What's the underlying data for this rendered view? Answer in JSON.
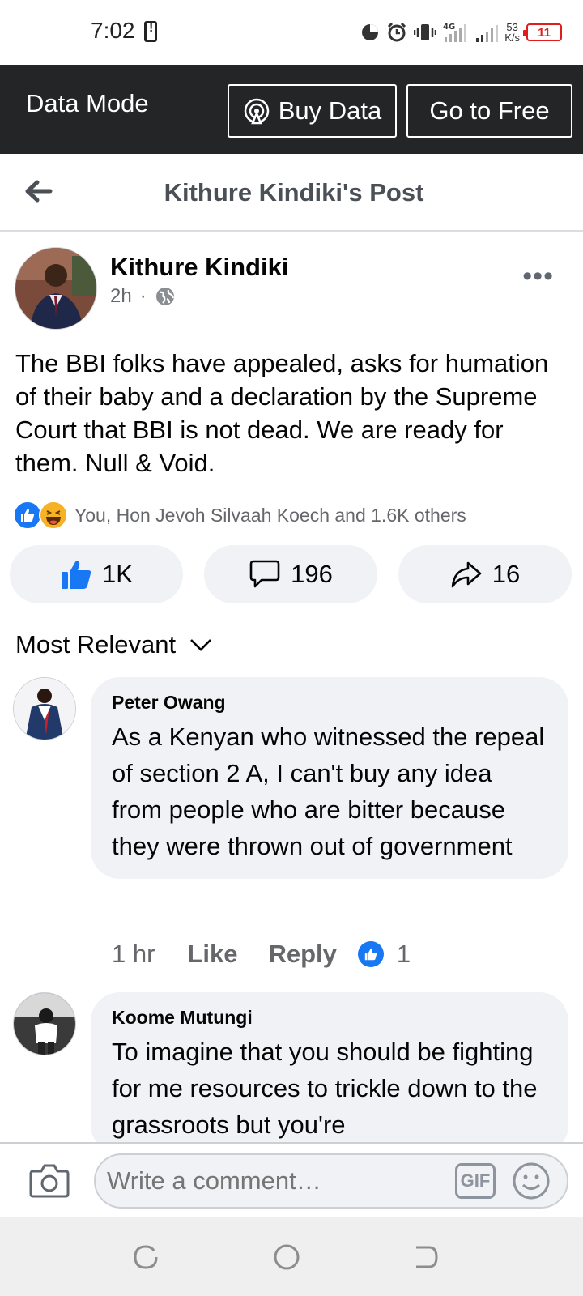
{
  "status_bar": {
    "time": "7:02",
    "network_speed_value": "53",
    "network_speed_unit": "K/s",
    "battery": "11",
    "network_type": "4G"
  },
  "data_mode_bar": {
    "title": "Data Mode",
    "buy_data_label": "Buy Data",
    "go_free_label": "Go to Free"
  },
  "header": {
    "title": "Kithure Kindiki's Post"
  },
  "post": {
    "author": "Kithure Kindiki",
    "time": "2h",
    "separator": "·",
    "text": "The BBI folks have appealed, asks for humation of their baby and a declaration by the Supreme Court that BBI is not dead. We are ready for them. Null & Void.",
    "reaction_summary": "You, Hon Jevoh Silvaah Koech and 1.6K others",
    "likes": "1K",
    "comments": "196",
    "shares": "16"
  },
  "sort_label": "Most Relevant",
  "comments": [
    {
      "author": "Peter Owang",
      "text": "As a Kenyan who witnessed the repeal of section 2 A, I can't buy any idea from people who are bitter because they were thrown out of government",
      "time": "1 hr",
      "like_label": "Like",
      "reply_label": "Reply",
      "reaction_count": "1"
    },
    {
      "author": "Koome Mutungi",
      "text": "To imagine that you should be fighting for me resources to trickle down to the grassroots but you're"
    }
  ],
  "composer": {
    "placeholder": "Write a comment…",
    "gif_label": "GIF"
  },
  "colors": {
    "facebook_blue": "#1877f2",
    "data_bar_bg": "#242526",
    "bubble_bg": "#f0f2f5",
    "secondary_text": "#65676b",
    "battery_low": "#e21b1b"
  }
}
